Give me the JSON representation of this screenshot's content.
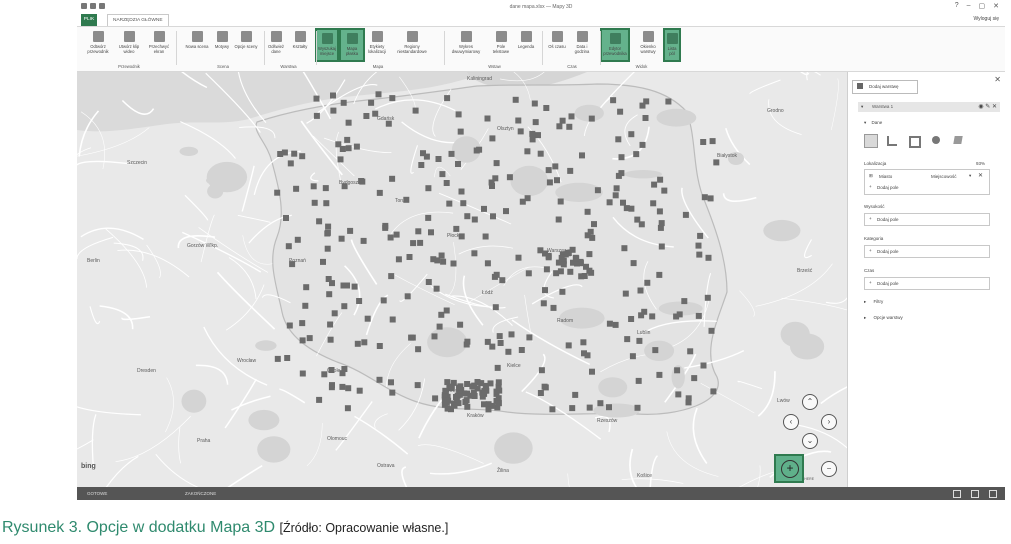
{
  "window": {
    "title": "dane mapa.xlsx — Mapy 3D",
    "minimize": "–",
    "restore": "▢",
    "close": "✕",
    "help": "?"
  },
  "tabs": {
    "file": "PLIK",
    "context": "NARZĘDZIA GŁÓWNE",
    "signout": "Wyloguj się"
  },
  "ribbon": {
    "buttons": [
      {
        "id": "play-tour",
        "label": "Odtwórz przewodnik",
        "icon": "play-icon"
      },
      {
        "id": "create-video",
        "label": "Utwórz klip wideo",
        "icon": "video-icon"
      },
      {
        "id": "capture-screen",
        "label": "Przechwyć ekran",
        "icon": "camera-icon"
      },
      {
        "id": "new-scene",
        "label": "Nowa scena",
        "icon": "scene-icon"
      },
      {
        "id": "themes",
        "label": "Motywy",
        "icon": "palette-icon"
      },
      {
        "id": "scene-options",
        "label": "Opcje sceny",
        "icon": "options-icon"
      },
      {
        "id": "refresh-data",
        "label": "Odśwież dane",
        "icon": "refresh-icon"
      },
      {
        "id": "shapes",
        "label": "Kształty",
        "icon": "shapes-icon"
      },
      {
        "id": "find-place",
        "label": "Wyszukaj miejsce",
        "icon": "search-place-icon",
        "highlight": true
      },
      {
        "id": "flat-map",
        "label": "Mapa płaska",
        "icon": "flat-map-icon",
        "highlight": true
      },
      {
        "id": "map-labels",
        "label": "Etykiety lokalizacji",
        "icon": "label-icon"
      },
      {
        "id": "custom-regions",
        "label": "Regiony niestandardowe",
        "icon": "region-icon"
      },
      {
        "id": "chart-2d",
        "label": "Wykres dwuwymiarowy",
        "icon": "chart-icon"
      },
      {
        "id": "text-box",
        "label": "Pole tekstowe",
        "icon": "textbox-icon"
      },
      {
        "id": "legend",
        "label": "Legenda",
        "icon": "legend-icon"
      },
      {
        "id": "time",
        "label": "Oś czasu",
        "icon": "clock-icon"
      },
      {
        "id": "date-time",
        "label": "Data i godzina",
        "icon": "calendar-icon"
      },
      {
        "id": "tour-editor",
        "label": "Edytor przewodnika",
        "icon": "tour-editor-icon",
        "highlight": true
      },
      {
        "id": "layer-pane",
        "label": "Okienko warstwy",
        "icon": "layer-pane-icon"
      },
      {
        "id": "field-list",
        "label": "Lista pól",
        "icon": "field-list-icon",
        "highlight": true
      }
    ],
    "groups": [
      {
        "id": "tour",
        "label": "Przewodnik"
      },
      {
        "id": "scene",
        "label": "Scena"
      },
      {
        "id": "layer",
        "label": "Warstwa"
      },
      {
        "id": "map",
        "label": "Mapa"
      },
      {
        "id": "insert",
        "label": "Wstaw"
      },
      {
        "id": "time",
        "label": "Czas"
      },
      {
        "id": "view",
        "label": "Widok"
      }
    ]
  },
  "map": {
    "cities": [
      "Kaliningrad",
      "Gdańsk",
      "Olsztyn",
      "Białystok",
      "Bydgoszcz",
      "Toruń",
      "Poznań",
      "Warszawa",
      "Łódź",
      "Lublin",
      "Wrocław",
      "Katowice",
      "Kraków",
      "Rzeszów",
      "Szczecin",
      "Gorzów Wlkp.",
      "Kielce",
      "Opole",
      "Radom",
      "Płock",
      "Grodno",
      "Brześć",
      "Lwów",
      "Berlin",
      "Dresden",
      "Praha",
      "Olomouc",
      "Ostrava",
      "Žilina",
      "Košice"
    ],
    "bing": "bing",
    "copyright": "© 2017 HERE"
  },
  "panel": {
    "add_layer": "Dodaj warstwę",
    "layer_name": "Warstwa 1",
    "data_section": "Dane",
    "location_label": "Lokalizacja",
    "location_pct": "93%",
    "location_field": "Miasto",
    "location_type": "Miejscowość",
    "add_field": "Dodaj pole",
    "height_label": "Wysokość",
    "category_label": "Kategoria",
    "time_label": "Czas",
    "filters": "Filtry",
    "layer_options": "Opcje warstwy"
  },
  "status": {
    "ready": "GOTOWE",
    "completed": "ZAKOŃCZONE"
  },
  "caption": {
    "title": "Rysunek 3. Opcje w dodatku Mapa 3D",
    "source": "[Źródło: Opracowanie własne.]"
  },
  "colors": {
    "accent_green": "#2f7a4f",
    "highlight_green": "#64b28c",
    "caption_green": "#2f8a6e",
    "marker": "#6b6b6b"
  }
}
